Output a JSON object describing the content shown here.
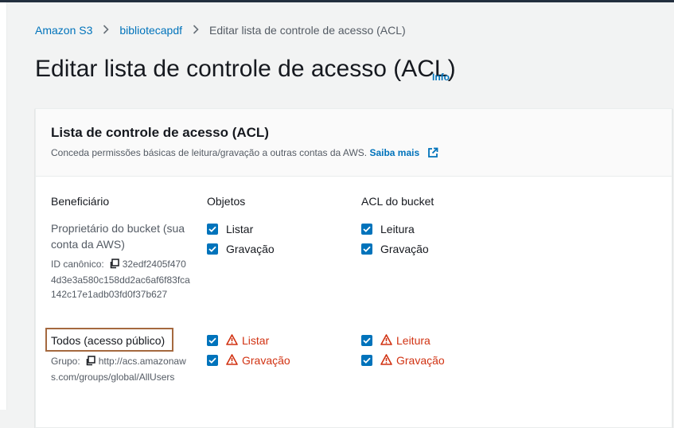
{
  "breadcrumb": {
    "items": [
      "Amazon S3",
      "bibliotecapdf",
      "Editar lista de controle de acesso (ACL)"
    ]
  },
  "page": {
    "title": "Editar lista de controle de acesso (ACL)",
    "info": "Info"
  },
  "panel": {
    "title": "Lista de controle de acesso (ACL)",
    "description": "Conceda permissões básicas de leitura/gravação a outras contas da AWS.",
    "learn_more": "Saiba mais"
  },
  "columns": {
    "grantee": "Beneficiário",
    "objects": "Objetos",
    "bucket_acl": "ACL do bucket"
  },
  "rows": [
    {
      "grantee": "Proprietário do bucket (sua conta da AWS)",
      "id_label": "ID canônico:",
      "id_value": "32edf2405f4704d3e3a580c158dd2ac6af6f83fca142c17e1adb03fd0f37b627",
      "objects": {
        "list": "Listar",
        "write": "Gravação"
      },
      "bucket": {
        "read": "Leitura",
        "write": "Gravação"
      }
    },
    {
      "grantee": "Todos (acesso público)",
      "group_label": "Grupo:",
      "group_value": "http://acs.amazonaws.com/groups/global/AllUsers",
      "objects": {
        "list": "Listar",
        "write": "Gravação"
      },
      "bucket": {
        "read": "Leitura",
        "write": "Gravação"
      }
    }
  ],
  "colors": {
    "link": "#0073bb",
    "warning": "#d13212",
    "highlight": "#a5693f"
  },
  "icons": [
    "chevron-right-icon",
    "external-link-icon",
    "copy-icon",
    "warning-icon",
    "checkbox-checked-icon"
  ]
}
